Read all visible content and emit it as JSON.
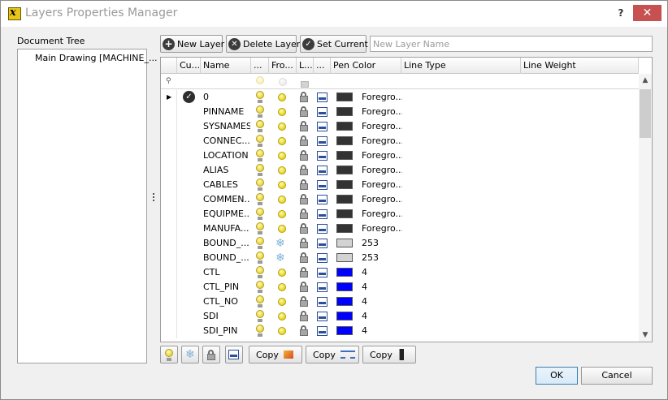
{
  "window": {
    "title": "Layers Properties Manager",
    "help_label": "?",
    "close_label": "✕"
  },
  "document_tree": {
    "label": "Document Tree",
    "items": [
      "Main Drawing [MACHINE_..."
    ]
  },
  "toolbar": {
    "new_layer": "New Layer",
    "delete_layer": "Delete Layer",
    "set_current": "Set Current",
    "new_layer_placeholder": "New Layer Name"
  },
  "grid": {
    "columns": [
      "Cu...",
      "Name",
      "...",
      "Fro...",
      "L...",
      "...",
      "Pen Color",
      "Line Type",
      "Line Weight"
    ],
    "rows": [
      {
        "current": true,
        "name": "0",
        "frozen": false,
        "color_hex": "#333333",
        "color_label": "Foregro..."
      },
      {
        "current": false,
        "name": "PINNAME",
        "frozen": false,
        "color_hex": "#333333",
        "color_label": "Foregro..."
      },
      {
        "current": false,
        "name": "SYSNAMES",
        "frozen": false,
        "color_hex": "#333333",
        "color_label": "Foregro..."
      },
      {
        "current": false,
        "name": "CONNEC...",
        "frozen": false,
        "color_hex": "#333333",
        "color_label": "Foregro..."
      },
      {
        "current": false,
        "name": "LOCATION",
        "frozen": false,
        "color_hex": "#333333",
        "color_label": "Foregro..."
      },
      {
        "current": false,
        "name": "ALIAS",
        "frozen": false,
        "color_hex": "#333333",
        "color_label": "Foregro..."
      },
      {
        "current": false,
        "name": "CABLES",
        "frozen": false,
        "color_hex": "#333333",
        "color_label": "Foregro..."
      },
      {
        "current": false,
        "name": "COMMEN...",
        "frozen": false,
        "color_hex": "#333333",
        "color_label": "Foregro..."
      },
      {
        "current": false,
        "name": "EQUIPME...",
        "frozen": false,
        "color_hex": "#333333",
        "color_label": "Foregro..."
      },
      {
        "current": false,
        "name": "MANUFA...",
        "frozen": false,
        "color_hex": "#333333",
        "color_label": "Foregro..."
      },
      {
        "current": false,
        "name": "BOUND_...",
        "frozen": true,
        "color_hex": "#d3d3d3",
        "color_label": "253"
      },
      {
        "current": false,
        "name": "BOUND_...",
        "frozen": true,
        "color_hex": "#d3d3d3",
        "color_label": "253"
      },
      {
        "current": false,
        "name": "CTL",
        "frozen": false,
        "color_hex": "#0000ff",
        "color_label": "4"
      },
      {
        "current": false,
        "name": "CTL_PIN",
        "frozen": false,
        "color_hex": "#0000ff",
        "color_label": "4"
      },
      {
        "current": false,
        "name": "CTL_NO",
        "frozen": false,
        "color_hex": "#0000ff",
        "color_label": "4"
      },
      {
        "current": false,
        "name": "SDI",
        "frozen": false,
        "color_hex": "#0000ff",
        "color_label": "4"
      },
      {
        "current": false,
        "name": "SDI_PIN",
        "frozen": false,
        "color_hex": "#0000ff",
        "color_label": "4"
      }
    ]
  },
  "bottom_toolbar": {
    "icons": [
      "bulb-icon",
      "snowflake-icon",
      "lock-icon",
      "printer-icon"
    ],
    "copy_buttons": [
      {
        "label": "Copy",
        "icon": "paint-icon"
      },
      {
        "label": "Copy",
        "icon": "line-type-icon"
      },
      {
        "label": "Copy",
        "icon": "line-weight-icon"
      }
    ]
  },
  "dialog_buttons": {
    "ok": "OK",
    "cancel": "Cancel"
  }
}
